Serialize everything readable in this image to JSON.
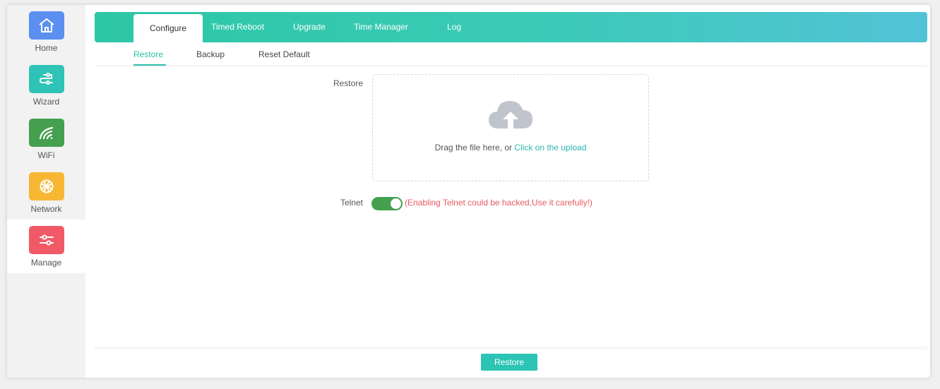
{
  "sidebar": {
    "items": [
      {
        "label": "Home",
        "icon": "home-icon",
        "color": "#5b8ff0"
      },
      {
        "label": "Wizard",
        "icon": "wizard-icon",
        "color": "#2ec3b6"
      },
      {
        "label": "WiFi",
        "icon": "wifi-icon",
        "color": "#44a04f"
      },
      {
        "label": "Network",
        "icon": "globe-icon",
        "color": "#f7b733"
      },
      {
        "label": "Manage",
        "icon": "sliders-icon",
        "color": "#f05a66",
        "active": true
      }
    ]
  },
  "header": {
    "tabs": [
      {
        "label": "Configure",
        "active": true
      },
      {
        "label": "Timed Reboot"
      },
      {
        "label": "Upgrade"
      },
      {
        "label": "Time Manager"
      },
      {
        "label": "Log"
      }
    ]
  },
  "subtabs": [
    {
      "label": "Restore",
      "active": true
    },
    {
      "label": "Backup"
    },
    {
      "label": "Reset Default"
    }
  ],
  "form": {
    "restore_label": "Restore",
    "upload_text": "Drag the file here, or",
    "upload_link": "Click on the upload",
    "telnet_label": "Telnet",
    "telnet_enabled": true,
    "telnet_warning": "(Enabling Telnet could be hacked,Use it carefully!)"
  },
  "footer": {
    "restore_button": "Restore"
  },
  "colors": {
    "accent": "#2cc0a8",
    "warning": "#e85a64",
    "toggle_on": "#44a04f"
  }
}
